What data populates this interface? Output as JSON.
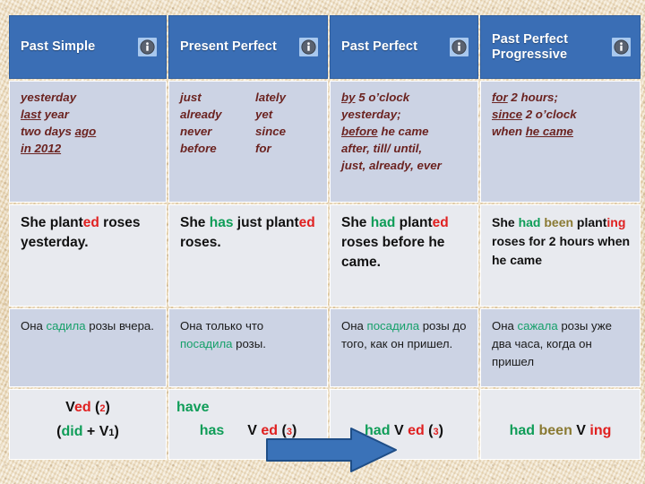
{
  "page": {
    "title": "English Past Tenses Comparison Table",
    "background_color": "#ecdcbd",
    "header_color": "#3a6eb5",
    "marker_row_color": "#ccd3e4",
    "example_row_color": "#e8eaef",
    "accent_green": "#0f9d58",
    "accent_red": "#e02020",
    "accent_olive": "#8a7a33",
    "marker_text_color": "#6b2320"
  },
  "columns": [
    {
      "id": "past-simple",
      "header": "Past Simple",
      "info_icon": "info-icon",
      "markers_layout": "single",
      "markers": [
        [
          {
            "text": "yesterday",
            "underline": []
          },
          {
            "text": "last year",
            "underline": [
              "last"
            ]
          },
          {
            "text": "two days ago ",
            "underline": [
              "ago"
            ]
          },
          {
            "text": "in 2012 ",
            "underline": [
              "in 2012"
            ]
          }
        ]
      ],
      "example": {
        "parts": [
          {
            "t": "She  plant",
            "c": "black"
          },
          {
            "t": "ed",
            "c": "red"
          },
          {
            "t": " roses yesterday.",
            "c": "black"
          }
        ],
        "plain": "She planted roses yesterday."
      },
      "russian": {
        "parts": [
          {
            "t": "Она ",
            "c": "black"
          },
          {
            "t": "садила",
            "c": "green"
          },
          {
            "t": " розы вчера.",
            "c": "black"
          }
        ],
        "plain": "Она садила розы вчера."
      },
      "formula": {
        "line1": [
          {
            "t": "V",
            "c": "black"
          },
          {
            "t": "ed",
            "c": "red"
          },
          {
            "t": " (",
            "c": "black"
          },
          {
            "t": "2",
            "c": "red",
            "sub": true
          },
          {
            "t": ")",
            "c": "black"
          }
        ],
        "line2": [
          {
            "t": "(",
            "c": "black"
          },
          {
            "t": "did",
            "c": "green"
          },
          {
            "t": " + V",
            "c": "black"
          },
          {
            "t": "1",
            "c": "black",
            "sub": true
          },
          {
            "t": ")",
            "c": "black"
          }
        ],
        "plain": "Ved (2) / (did + V1)"
      }
    },
    {
      "id": "present-perfect",
      "header": "Present Perfect",
      "info_icon": "info-icon",
      "markers_layout": "double",
      "markers": [
        [
          {
            "text": "just",
            "underline": []
          },
          {
            "text": "already",
            "underline": []
          },
          {
            "text": "never",
            "underline": []
          },
          {
            "text": "before",
            "underline": []
          }
        ],
        [
          {
            "text": "lately",
            "underline": []
          },
          {
            "text": "yet",
            "underline": []
          },
          {
            "text": "since",
            "underline": []
          },
          {
            "text": "for",
            "underline": []
          }
        ]
      ],
      "example": {
        "parts": [
          {
            "t": "She ",
            "c": "black"
          },
          {
            "t": "has",
            "c": "green"
          },
          {
            "t": " just plant",
            "c": "black"
          },
          {
            "t": "ed",
            "c": "red"
          },
          {
            "t": " roses.",
            "c": "black"
          }
        ],
        "plain": "She has just planted roses."
      },
      "russian": {
        "parts": [
          {
            "t": "Она только что ",
            "c": "black"
          },
          {
            "t": "посадила",
            "c": "green"
          },
          {
            "t": " розы.",
            "c": "black"
          }
        ],
        "plain": "Она только что посадила розы."
      },
      "formula": {
        "line1": [
          {
            "t": "have",
            "c": "green"
          }
        ],
        "line2": [
          {
            "t": "has",
            "c": "green"
          }
        ],
        "right": [
          {
            "t": "V ",
            "c": "black"
          },
          {
            "t": "ed",
            "c": "red"
          },
          {
            "t": " (",
            "c": "black"
          },
          {
            "t": "3",
            "c": "red",
            "sub": true
          },
          {
            "t": ")",
            "c": "black"
          }
        ],
        "plain": "have / has  V ed (3)"
      }
    },
    {
      "id": "past-perfect",
      "header": "Past Perfect",
      "info_icon": "info-icon",
      "markers_layout": "single",
      "markers": [
        [
          {
            "text": "by 5 o’clock",
            "underline": [
              "by"
            ]
          },
          {
            "text": "yesterday;",
            "underline": []
          },
          {
            "text": "before he came",
            "underline": [
              "before"
            ]
          },
          {
            "text": "after, till/ until,",
            "underline": []
          },
          {
            "text": "just, already, ever",
            "underline": []
          }
        ]
      ],
      "example": {
        "parts": [
          {
            "t": "She ",
            "c": "black"
          },
          {
            "t": "had",
            "c": "green"
          },
          {
            "t": " plant",
            "c": "black"
          },
          {
            "t": "ed",
            "c": "red"
          },
          {
            "t": " roses before he came.",
            "c": "black"
          }
        ],
        "plain": "She had planted roses before he came."
      },
      "russian": {
        "parts": [
          {
            "t": "Она  ",
            "c": "black"
          },
          {
            "t": "посадила",
            "c": "green"
          },
          {
            "t": " розы до того, как он пришел.",
            "c": "black"
          }
        ],
        "plain": "Она посадила розы до того, как он пришел."
      },
      "formula": {
        "line1": [
          {
            "t": "had",
            "c": "green"
          },
          {
            "t": "   ",
            "c": "black"
          },
          {
            "t": "V ",
            "c": "black"
          },
          {
            "t": "ed",
            "c": "red"
          },
          {
            "t": " (",
            "c": "black"
          },
          {
            "t": "3",
            "c": "red",
            "sub": true
          },
          {
            "t": ")",
            "c": "black"
          }
        ],
        "plain": "had  V ed (3)"
      }
    },
    {
      "id": "past-perfect-progressive",
      "header": "Past Perfect Progressive",
      "info_icon": "info-icon",
      "markers_layout": "single",
      "markers": [
        [
          {
            "text": "for  2 hours;",
            "underline": [
              "for"
            ]
          },
          {
            "text": "since  2 o’clock",
            "underline": [
              "since"
            ]
          },
          {
            "text": "when he came",
            "underline": [
              "he came"
            ]
          }
        ]
      ],
      "example": {
        "parts": [
          {
            "t": "She ",
            "c": "black"
          },
          {
            "t": "had",
            "c": "green"
          },
          {
            "t": " ",
            "c": "black"
          },
          {
            "t": "been",
            "c": "olive"
          },
          {
            "t": " plant",
            "c": "black"
          },
          {
            "t": "ing",
            "c": "red"
          },
          {
            "t": " roses for 2 hours when he came",
            "c": "black"
          }
        ],
        "plain": "She had been planting roses for 2 hours when he came"
      },
      "russian": {
        "parts": [
          {
            "t": "Она ",
            "c": "black"
          },
          {
            "t": "сажала",
            "c": "green"
          },
          {
            "t": " розы уже два часа, когда он пришел",
            "c": "black"
          }
        ],
        "plain": "Она сажала розы уже два часа, когда он пришел"
      },
      "formula": {
        "line1": [
          {
            "t": "had",
            "c": "green"
          },
          {
            "t": " ",
            "c": "black"
          },
          {
            "t": "been",
            "c": "olive"
          },
          {
            "t": " V",
            "c": "black"
          },
          {
            "t": " ing",
            "c": "red"
          }
        ],
        "plain": "had been V ing"
      }
    }
  ],
  "arrow": {
    "name": "timeline-arrow",
    "direction": "right",
    "color": "#3a72b8",
    "border_color": "#1f4e87"
  }
}
